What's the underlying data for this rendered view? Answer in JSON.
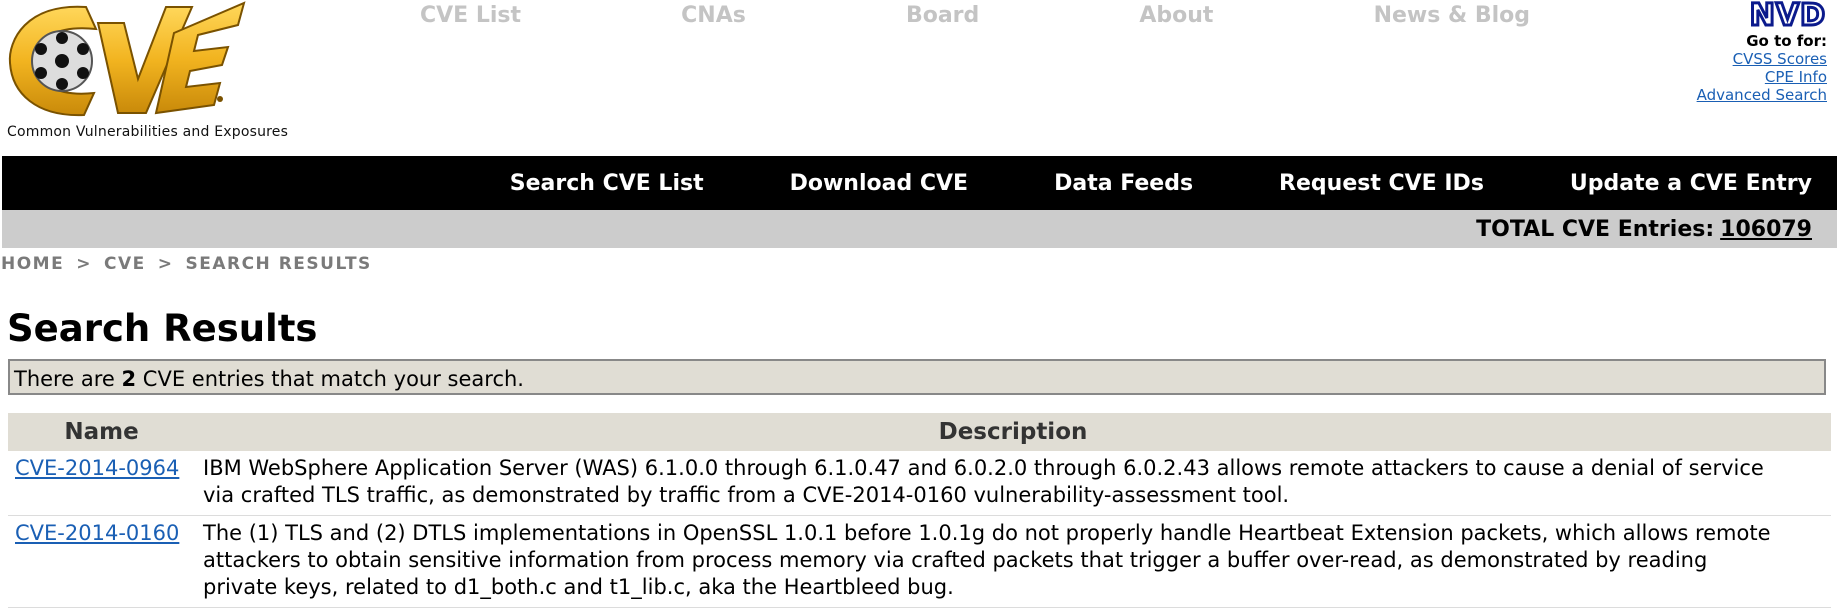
{
  "header": {
    "logo_caption": "Common Vulnerabilities and Exposures",
    "nav": [
      "CVE List",
      "CNAs",
      "Board",
      "About",
      "News & Blog"
    ],
    "nvd": {
      "logo_text": "NVD",
      "goto_label": "Go to for:",
      "links": [
        "CVSS Scores",
        "CPE Info",
        "Advanced Search"
      ]
    }
  },
  "menubar": {
    "items": [
      "Search CVE List",
      "Download CVE",
      "Data Feeds",
      "Request CVE IDs",
      "Update a CVE Entry"
    ]
  },
  "total": {
    "label": "TOTAL CVE Entries:",
    "count": "106079"
  },
  "breadcrumb": [
    "HOME",
    ">",
    "CVE",
    ">",
    "SEARCH RESULTS"
  ],
  "page_title": "Search Results",
  "match": {
    "prefix": "There are",
    "count": "2",
    "suffix": "CVE entries that match your search."
  },
  "table": {
    "headers": [
      "Name",
      "Description"
    ],
    "rows": [
      {
        "name": "CVE-2014-0964",
        "description": "IBM WebSphere Application Server (WAS) 6.1.0.0 through 6.1.0.47 and 6.0.2.0 through 6.0.2.43 allows remote attackers to cause a denial of service via crafted TLS traffic, as demonstrated by traffic from a CVE-2014-0160 vulnerability-assessment tool."
      },
      {
        "name": "CVE-2014-0160",
        "description": "The (1) TLS and (2) DTLS implementations in OpenSSL 1.0.1 before 1.0.1g do not properly handle Heartbeat Extension packets, which allows remote attackers to obtain sensitive information from process memory via crafted packets that trigger a buffer over-read, as demonstrated by reading private keys, related to d1_both.c and t1_lib.c, aka the Heartbleed bug."
      }
    ]
  },
  "colors": {
    "logo_gold": "#f2b420",
    "menubar_bg": "#000000",
    "totalbar_bg": "#cccccc",
    "table_header_bg": "#e0ddd4",
    "link": "#1a5fb4",
    "nav_text": "#c4c4c4",
    "nvd_blue": "#0b1a8c"
  }
}
